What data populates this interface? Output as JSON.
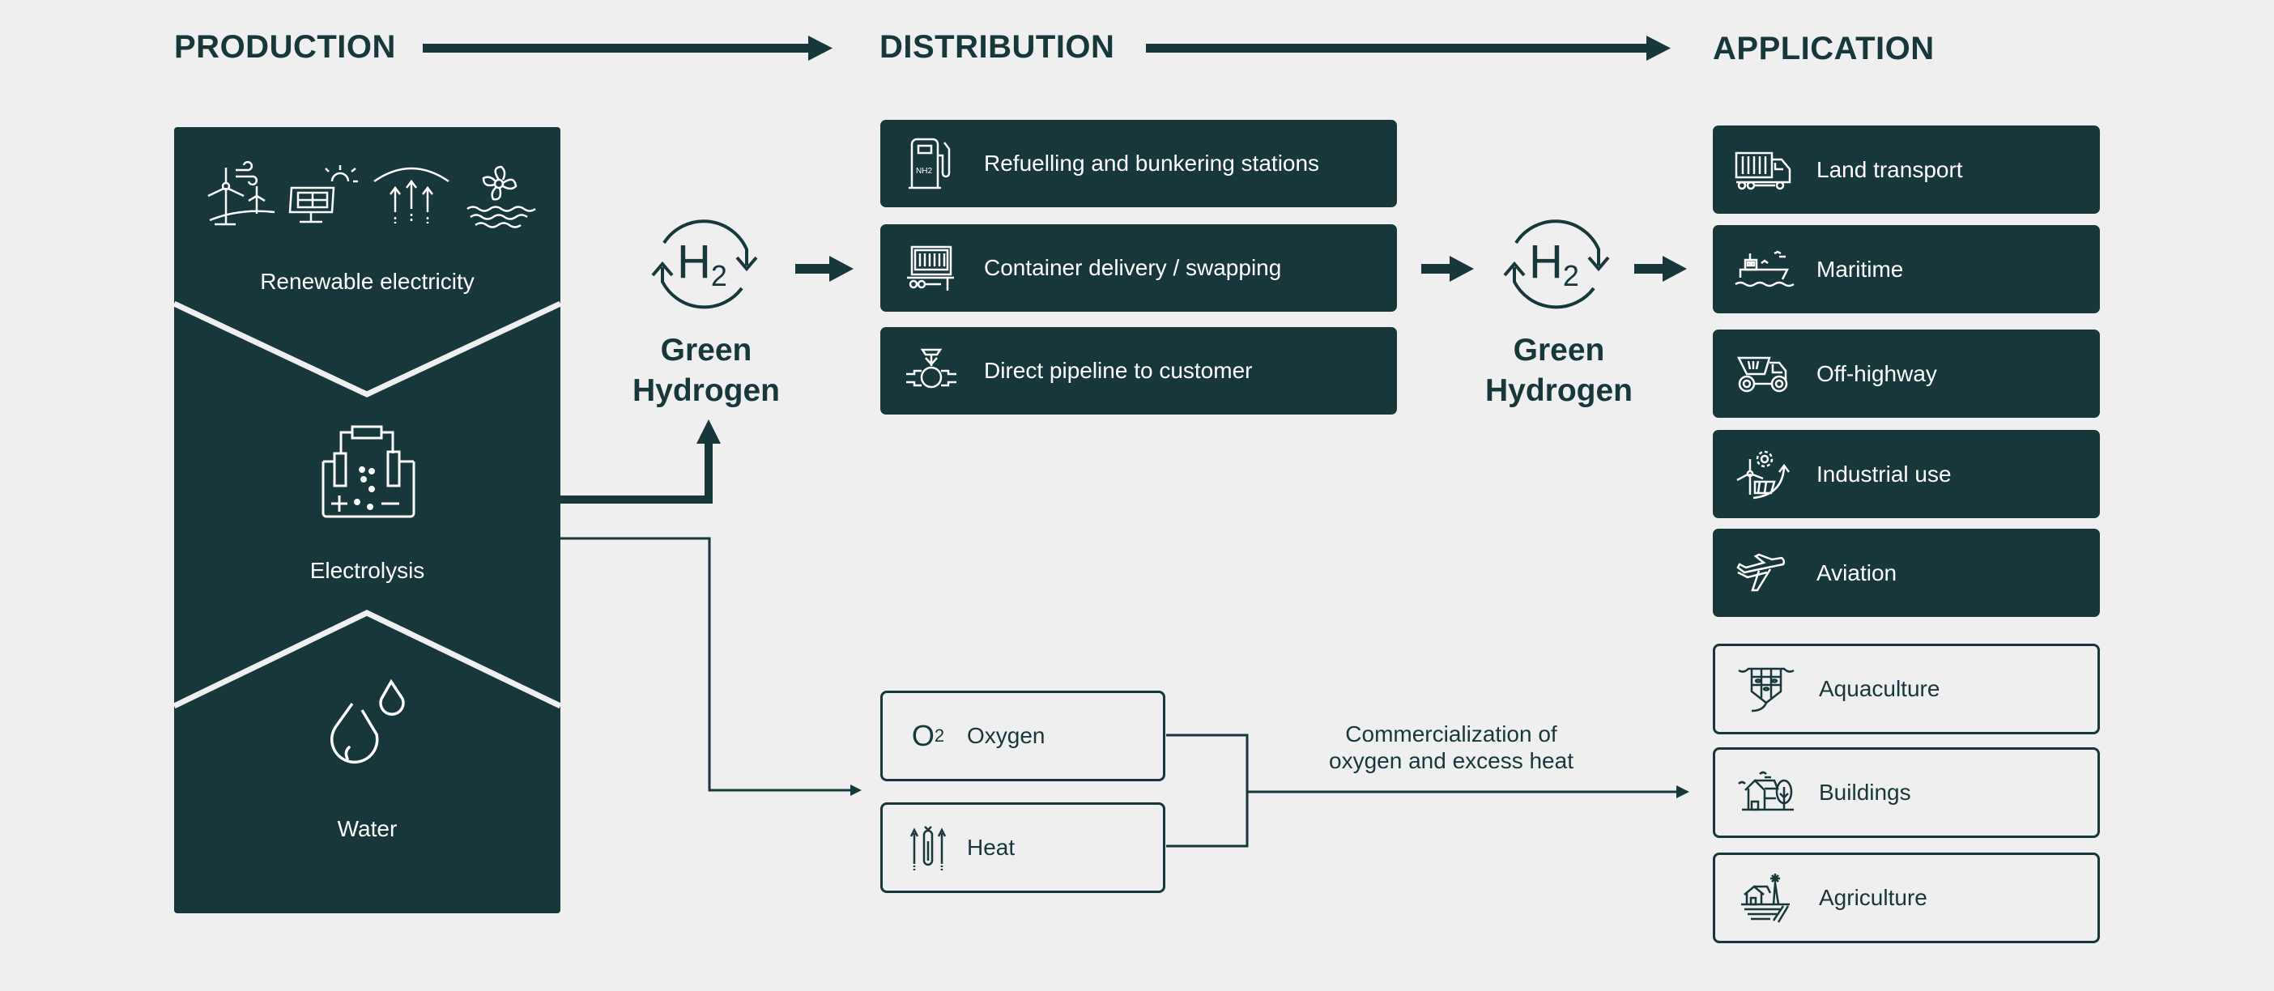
{
  "colors": {
    "primary": "#17373a",
    "background": "#efefef",
    "on_primary": "#ffffff"
  },
  "headers": {
    "production": "PRODUCTION",
    "distribution": "DISTRIBUTION",
    "application": "APPLICATION"
  },
  "production": {
    "sections": [
      {
        "label": "Renewable electricity",
        "icons": [
          "wind-turbine-icon",
          "solar-panel-icon",
          "geothermal-icon",
          "hydro-turbine-icon"
        ]
      },
      {
        "label": "Electrolysis",
        "icons": [
          "electrolysis-cell-icon"
        ]
      },
      {
        "label": "Water",
        "icons": [
          "water-drops-icon"
        ]
      }
    ]
  },
  "hydrogen_nodes": [
    {
      "symbol": "H",
      "subscript": "2",
      "line1": "Green",
      "line2": "Hydrogen"
    },
    {
      "symbol": "H",
      "subscript": "2",
      "line1": "Green",
      "line2": "Hydrogen"
    }
  ],
  "distribution": {
    "items": [
      {
        "label": "Refuelling and bunkering stations",
        "icon": "fuel-pump-icon",
        "icon_text": "NH2"
      },
      {
        "label": "Container delivery / swapping",
        "icon": "container-trailer-icon"
      },
      {
        "label": "Direct pipeline to customer",
        "icon": "pipeline-valve-icon"
      }
    ],
    "byproducts": [
      {
        "label": "Oxygen",
        "icon": "oxygen-icon",
        "symbol": "O",
        "subscript": "2"
      },
      {
        "label": "Heat",
        "icon": "heat-icon"
      }
    ],
    "byproduct_note": [
      "Commercialization of",
      "oxygen and excess heat"
    ]
  },
  "application": {
    "hydrogen_uses": [
      {
        "label": "Land transport",
        "icon": "truck-icon"
      },
      {
        "label": "Maritime",
        "icon": "ship-icon"
      },
      {
        "label": "Off-highway",
        "icon": "dump-truck-icon"
      },
      {
        "label": "Industrial use",
        "icon": "industry-icon"
      },
      {
        "label": "Aviation",
        "icon": "airplane-icon"
      }
    ],
    "byproduct_uses": [
      {
        "label": "Aquaculture",
        "icon": "fish-farm-icon"
      },
      {
        "label": "Buildings",
        "icon": "house-icon"
      },
      {
        "label": "Agriculture",
        "icon": "farm-icon"
      }
    ]
  }
}
